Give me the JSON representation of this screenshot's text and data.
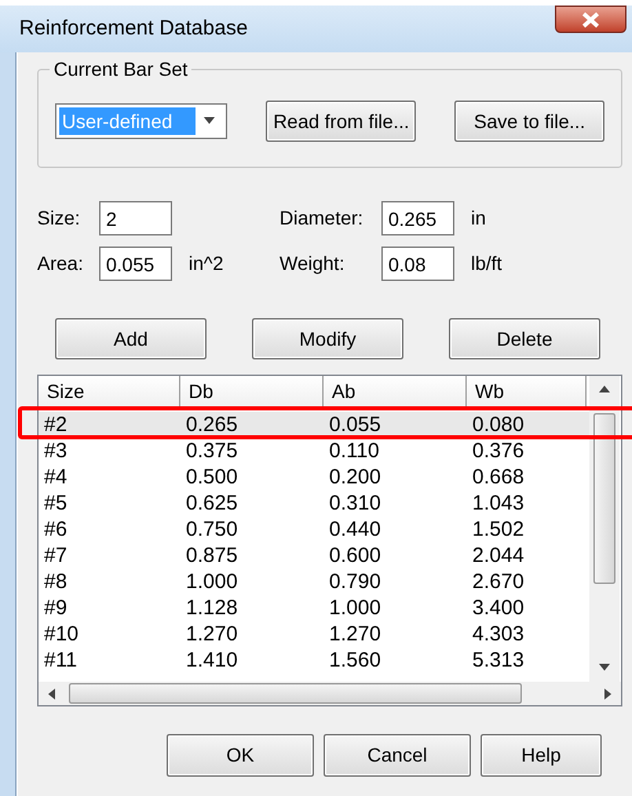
{
  "window": {
    "title": "Reinforcement Database"
  },
  "bar_set": {
    "legend": "Current Bar Set",
    "value": "User-defined",
    "buttons": [
      "Read from file...",
      "Save to file..."
    ]
  },
  "fields": [
    {
      "label": "Size:",
      "value": "2"
    },
    {
      "label": "Diameter:",
      "value": "0.265",
      "unit": "in"
    },
    {
      "label": "Area:",
      "value": "0.055",
      "unit": "in^2"
    },
    {
      "label": "Weight:",
      "value": "0.08",
      "unit": "lb/ft"
    }
  ],
  "actions": [
    "Add",
    "Modify",
    "Delete"
  ],
  "table": {
    "columns": [
      "Size",
      "Db",
      "Ab",
      "Wb"
    ],
    "rows": [
      {
        "cells": [
          "#2",
          "0.265",
          "0.055",
          "0.080"
        ],
        "selected": true
      },
      {
        "cells": [
          "#3",
          "0.375",
          "0.110",
          "0.376"
        ],
        "selected": false
      },
      {
        "cells": [
          "#4",
          "0.500",
          "0.200",
          "0.668"
        ],
        "selected": false
      },
      {
        "cells": [
          "#5",
          "0.625",
          "0.310",
          "1.043"
        ],
        "selected": false
      },
      {
        "cells": [
          "#6",
          "0.750",
          "0.440",
          "1.502"
        ],
        "selected": false
      },
      {
        "cells": [
          "#7",
          "0.875",
          "0.600",
          "2.044"
        ],
        "selected": false
      },
      {
        "cells": [
          "#8",
          "1.000",
          "0.790",
          "2.670"
        ],
        "selected": false
      },
      {
        "cells": [
          "#9",
          "1.128",
          "1.000",
          "3.400"
        ],
        "selected": false
      },
      {
        "cells": [
          "#10",
          "1.270",
          "1.270",
          "4.303"
        ],
        "selected": false
      },
      {
        "cells": [
          "#11",
          "1.410",
          "1.560",
          "5.313"
        ],
        "selected": false
      }
    ]
  },
  "buttons": [
    "OK",
    "Cancel",
    "Help"
  ]
}
